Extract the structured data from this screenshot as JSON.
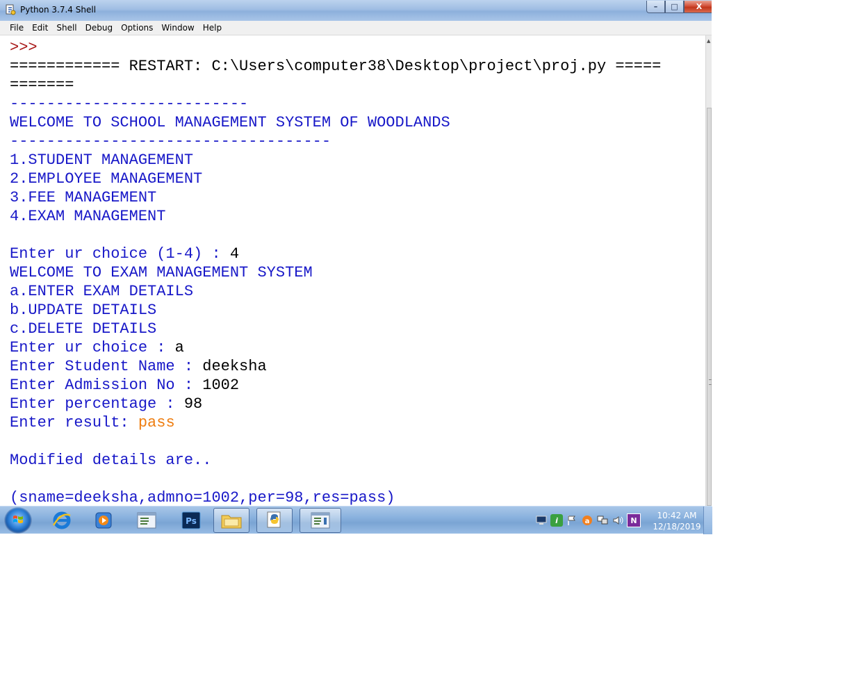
{
  "window": {
    "title": "Python 3.7.4 Shell",
    "buttons": {
      "minimize": "–",
      "maximize": "□",
      "close": "X"
    }
  },
  "menu": [
    "File",
    "Edit",
    "Shell",
    "Debug",
    "Options",
    "Window",
    "Help"
  ],
  "shell_lines": [
    {
      "text": ">>>",
      "color": "red"
    },
    {
      "text": "============ RESTART: C:\\Users\\computer38\\Desktop\\project\\proj.py =====",
      "color": "black"
    },
    {
      "text": "=======",
      "color": "black"
    },
    {
      "text": "--------------------------",
      "color": "blue"
    },
    {
      "text": "WELCOME TO SCHOOL MANAGEMENT SYSTEM OF WOODLANDS",
      "color": "blue"
    },
    {
      "text": "-----------------------------------",
      "color": "blue"
    },
    {
      "text": "1.STUDENT MANAGEMENT",
      "color": "blue"
    },
    {
      "text": "2.EMPLOYEE MANAGEMENT",
      "color": "blue"
    },
    {
      "text": "3.FEE MANAGEMENT",
      "color": "blue"
    },
    {
      "text": "4.EXAM MANAGEMENT",
      "color": "blue"
    },
    {
      "text": "",
      "color": "blue"
    },
    {
      "prompt": "Enter ur choice (1-4) : ",
      "input": "4",
      "input_color": "black"
    },
    {
      "text": "WELCOME TO EXAM MANAGEMENT SYSTEM",
      "color": "blue"
    },
    {
      "text": "a.ENTER EXAM DETAILS",
      "color": "blue"
    },
    {
      "text": "b.UPDATE DETAILS",
      "color": "blue"
    },
    {
      "text": "c.DELETE DETAILS",
      "color": "blue"
    },
    {
      "prompt": "Enter ur choice : ",
      "input": "a",
      "input_color": "black"
    },
    {
      "prompt": "Enter Student Name : ",
      "input": "deeksha",
      "input_color": "black"
    },
    {
      "prompt": "Enter Admission No : ",
      "input": "1002",
      "input_color": "black"
    },
    {
      "prompt": "Enter percentage : ",
      "input": "98",
      "input_color": "black"
    },
    {
      "prompt": "Enter result: ",
      "input": "pass",
      "input_color": "orange"
    },
    {
      "text": "",
      "color": "blue"
    },
    {
      "text": "Modified details are..",
      "color": "blue"
    },
    {
      "text": "",
      "color": "blue"
    },
    {
      "text": "(sname=deeksha,admno=1002,per=98,res=pass)",
      "color": "blue"
    }
  ],
  "taskbar": {
    "apps": [
      "start-orb",
      "internet-explorer-icon",
      "media-player-icon",
      "notepad-icon",
      "photoshop-icon",
      "folder-icon",
      "python-icon",
      "window-icon"
    ],
    "photoshop_label": "Ps",
    "tray": [
      "network-icon",
      "info-icon",
      "flag-icon",
      "avast-icon",
      "display-icon",
      "volume-icon",
      "onenote-icon"
    ],
    "tray_info": "i",
    "tray_onenote": "N",
    "clock_time": "10:42 AM",
    "clock_date": "12/18/2019"
  },
  "colors": {
    "blue": "#1818c8",
    "red": "#a81818",
    "orange": "#ee7d10",
    "black": "#000000"
  }
}
